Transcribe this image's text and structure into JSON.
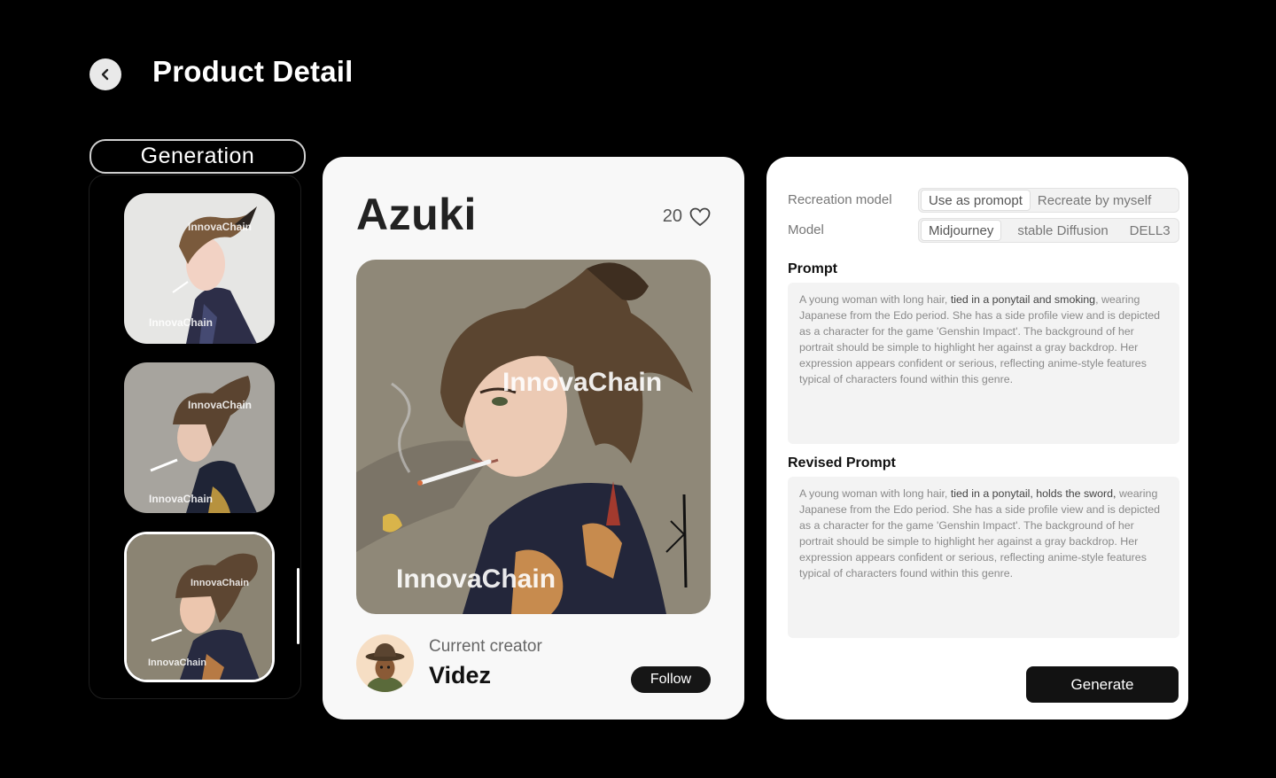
{
  "header": {
    "title": "Product Detail"
  },
  "sidebar": {
    "tab_label": "Generation",
    "watermark": "InnovaChain"
  },
  "product": {
    "name": "Azuki",
    "likes": "20",
    "watermark": "InnovaChain",
    "creator_label": "Current creator",
    "creator_name": "Videz",
    "follow_label": "Follow"
  },
  "settings": {
    "recreation_label": "Recreation model",
    "recreation_options": [
      "Use as promopt",
      "Recreate by myself"
    ],
    "recreation_selected": "Use as promopt",
    "model_label": "Model",
    "model_options": [
      "Midjourney",
      "stable Diffusion",
      "DELL3"
    ],
    "model_selected": "Midjourney",
    "prompt_title": "Prompt",
    "prompt_pre": "A young woman with long hair, ",
    "prompt_highlight": "tied in a ponytail and smoking",
    "prompt_post": ", wearing Japanese from the Edo period. She has a side profile view and is depicted as a character for the game 'Genshin Impact'. The background of her portrait should be simple to highlight her against a gray backdrop. Her expression appears confident or serious, reflecting anime-style features typical of characters found within this genre.",
    "revised_title": "Revised Prompt",
    "revised_pre": "A young woman with long hair, ",
    "revised_highlight": "tied in a ponytail, holds the sword,",
    "revised_post": " wearing Japanese from the Edo period. She has a side profile view and is depicted as a character for the game 'Genshin Impact'. The background of her portrait should be simple to highlight her against a gray backdrop. Her expression appears confident or serious, reflecting anime-style features typical of characters found within this genre.",
    "generate_label": "Generate"
  },
  "colors": {
    "background": "#000000",
    "card": "#f8f8f8",
    "primary_button": "#161616",
    "image_bg": "#8f8878"
  }
}
